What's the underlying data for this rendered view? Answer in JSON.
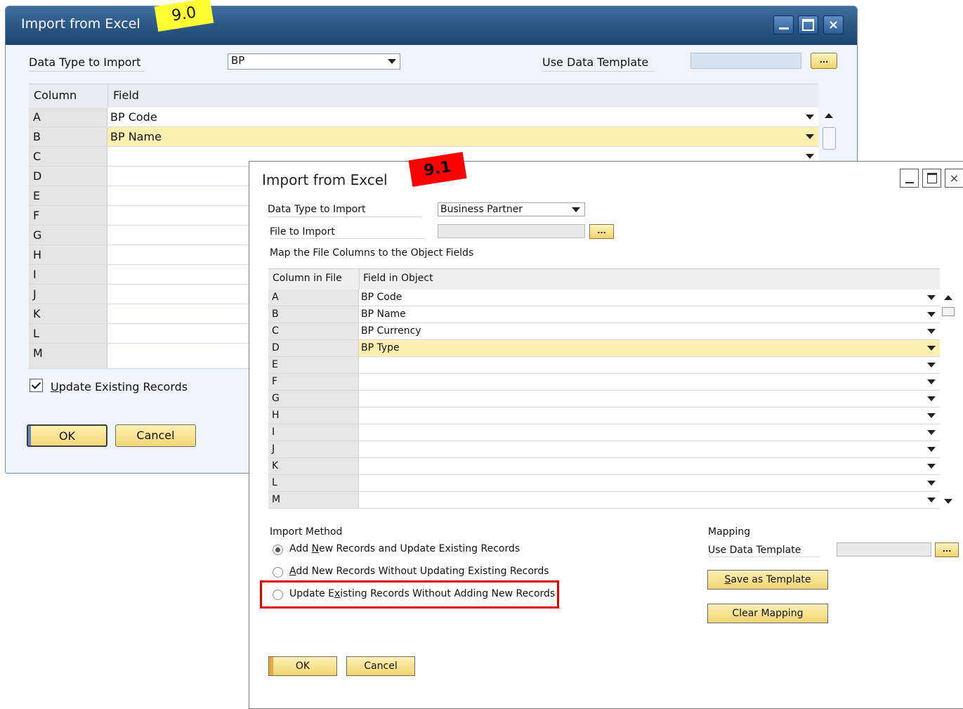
{
  "win90": {
    "title": "Import from Excel",
    "version_badge": "9.0",
    "data_type_label": "Data Type to Import",
    "data_type_value": "BP",
    "use_template_label": "Use Data Template",
    "dots": "...",
    "col_header": "Column",
    "field_header": "Field",
    "rows": [
      {
        "col": "A",
        "field": "BP Code"
      },
      {
        "col": "B",
        "field": "BP Name"
      },
      {
        "col": "C",
        "field": ""
      },
      {
        "col": "D",
        "field": ""
      },
      {
        "col": "E",
        "field": ""
      },
      {
        "col": "F",
        "field": ""
      },
      {
        "col": "G",
        "field": ""
      },
      {
        "col": "H",
        "field": ""
      },
      {
        "col": "I",
        "field": ""
      },
      {
        "col": "J",
        "field": ""
      },
      {
        "col": "K",
        "field": ""
      },
      {
        "col": "L",
        "field": ""
      },
      {
        "col": "M",
        "field": ""
      }
    ],
    "update_existing_label_u": "U",
    "update_existing_label_rest": "pdate Existing Records",
    "ok": "OK",
    "cancel": "Cancel",
    "min_icon": "_",
    "close_icon": "×"
  },
  "win91": {
    "title": "Import from Excel",
    "version_badge": "9.1",
    "data_type_label": "Data Type to Import",
    "data_type_value": "Business Partner",
    "file_label": "File to Import",
    "map_label": "Map the File Columns to the Object Fields",
    "dots": "...",
    "col_header": "Column in File",
    "field_header": "Field in Object",
    "rows": [
      {
        "col": "A",
        "field": "BP Code"
      },
      {
        "col": "B",
        "field": "BP Name"
      },
      {
        "col": "C",
        "field": "BP Currency"
      },
      {
        "col": "D",
        "field": "BP Type"
      },
      {
        "col": "E",
        "field": ""
      },
      {
        "col": "F",
        "field": ""
      },
      {
        "col": "G",
        "field": ""
      },
      {
        "col": "H",
        "field": ""
      },
      {
        "col": "I",
        "field": ""
      },
      {
        "col": "J",
        "field": ""
      },
      {
        "col": "K",
        "field": ""
      },
      {
        "col": "L",
        "field": ""
      },
      {
        "col": "M",
        "field": ""
      }
    ],
    "import_method_label": "Import Method",
    "radio1": {
      "pre": "Add ",
      "u": "N",
      "post": "ew Records and Update Existing Records"
    },
    "radio2": {
      "pre": "",
      "u": "A",
      "post": "dd New Records Without Updating Existing Records"
    },
    "radio3": {
      "pre": "Update E",
      "u": "x",
      "post": "isting Records Without Adding New Records"
    },
    "mapping_label": "Mapping",
    "use_template_label": "Use Data Template",
    "save_template": {
      "u": "S",
      "post": "ave as Template"
    },
    "clear_mapping": "Clear Mapping",
    "ok": "OK",
    "cancel": "Cancel",
    "min_icon": "_",
    "close_icon": "×"
  },
  "colors": {
    "title_blue": "#2b5583",
    "highlight_row": "#fbf0b0",
    "badge_yellow": "#ffff33",
    "badge_red": "#ff0000",
    "red_frame": "#e00000"
  }
}
